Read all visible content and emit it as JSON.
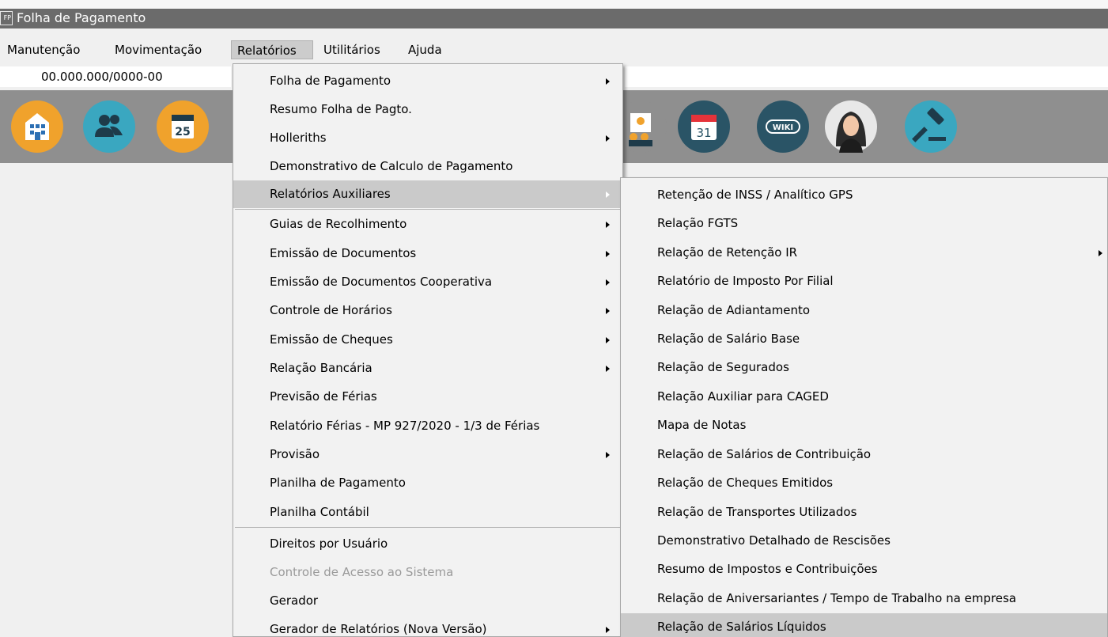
{
  "window": {
    "title": "Folha de Pagamento",
    "icon_text": "FP"
  },
  "menubar": {
    "items": [
      {
        "label": "Manutenção"
      },
      {
        "label": "Movimentação"
      },
      {
        "label": "Relatórios",
        "active": true
      },
      {
        "label": "Utilitários"
      },
      {
        "label": "Ajuda"
      }
    ]
  },
  "company_field": {
    "value": "00.000.000/0000-00"
  },
  "toolbar": {
    "buttons": [
      {
        "icon": "building-icon",
        "color": "#f0a22c"
      },
      {
        "icon": "users-icon",
        "color": "#3aa7c0"
      },
      {
        "icon": "calendar-25-icon",
        "color": "#f0a22c",
        "text": "25"
      },
      {
        "icon": "employees-icon",
        "color": "#f0a22c"
      },
      {
        "icon": "calendar-31-icon",
        "color": "#2a5466",
        "text": "31"
      },
      {
        "icon": "wiki-icon",
        "color": "#2a5466",
        "text": "WIKI"
      },
      {
        "icon": "assistant-avatar-icon",
        "color": "#e8e8e8"
      },
      {
        "icon": "gavel-icon",
        "color": "#3aa7c0"
      }
    ]
  },
  "relatorios_menu": {
    "items": [
      {
        "label": "Folha de Pagamento",
        "submenu": true
      },
      {
        "label": "Resumo Folha de Pagto.",
        "submenu": false
      },
      {
        "label": "Holleriths",
        "submenu": true
      },
      {
        "label": "Demonstrativo de Calculo de Pagamento",
        "submenu": false
      },
      {
        "label": "Relatórios Auxiliares",
        "submenu": true,
        "highlighted": true
      },
      {
        "label": "Guias de Recolhimento",
        "submenu": true
      },
      {
        "label": "Emissão de Documentos",
        "submenu": true
      },
      {
        "label": "Emissão de Documentos Cooperativa",
        "submenu": true
      },
      {
        "label": "Controle de Horários",
        "submenu": true
      },
      {
        "label": "Emissão de Cheques",
        "submenu": true
      },
      {
        "label": "Relação Bancária",
        "submenu": true
      },
      {
        "label": "Previsão de Férias",
        "submenu": false
      },
      {
        "label": "Relatório Férias - MP 927/2020 - 1/3 de Férias",
        "submenu": false
      },
      {
        "label": "Provisão",
        "submenu": true
      },
      {
        "label": "Planilha de Pagamento",
        "submenu": false
      },
      {
        "label": "Planilha Contábil",
        "submenu": false
      },
      {
        "label": "Direitos por Usuário",
        "submenu": false
      },
      {
        "label": "Controle de Acesso ao Sistema",
        "submenu": false,
        "disabled": true
      },
      {
        "label": "Gerador",
        "submenu": false
      },
      {
        "label": "Gerador de Relatórios (Nova Versão)",
        "submenu": true
      }
    ]
  },
  "auxiliares_menu": {
    "items": [
      {
        "label": "Retenção de INSS / Analítico GPS",
        "submenu": false
      },
      {
        "label": "Relação FGTS",
        "submenu": false
      },
      {
        "label": "Relação de Retenção IR",
        "submenu": true
      },
      {
        "label": "Relatório de Imposto Por Filial",
        "submenu": false
      },
      {
        "label": "Relação de Adiantamento",
        "submenu": false
      },
      {
        "label": "Relação de Salário Base",
        "submenu": false
      },
      {
        "label": "Relação de Segurados",
        "submenu": false
      },
      {
        "label": "Relação Auxiliar para CAGED",
        "submenu": false
      },
      {
        "label": "Mapa de Notas",
        "submenu": false
      },
      {
        "label": "Relação de Salários de Contribuição",
        "submenu": false
      },
      {
        "label": "Relação de Cheques Emitidos",
        "submenu": false
      },
      {
        "label": "Relação de Transportes Utilizados",
        "submenu": false
      },
      {
        "label": "Demonstrativo Detalhado de Rescisões",
        "submenu": false
      },
      {
        "label": "Resumo de Impostos e Contribuições",
        "submenu": false
      },
      {
        "label": "Relação de Aniversariantes / Tempo de Trabalho na empresa",
        "submenu": false
      },
      {
        "label": "Relação de Salários Líquidos",
        "submenu": false,
        "highlighted": true
      }
    ]
  }
}
